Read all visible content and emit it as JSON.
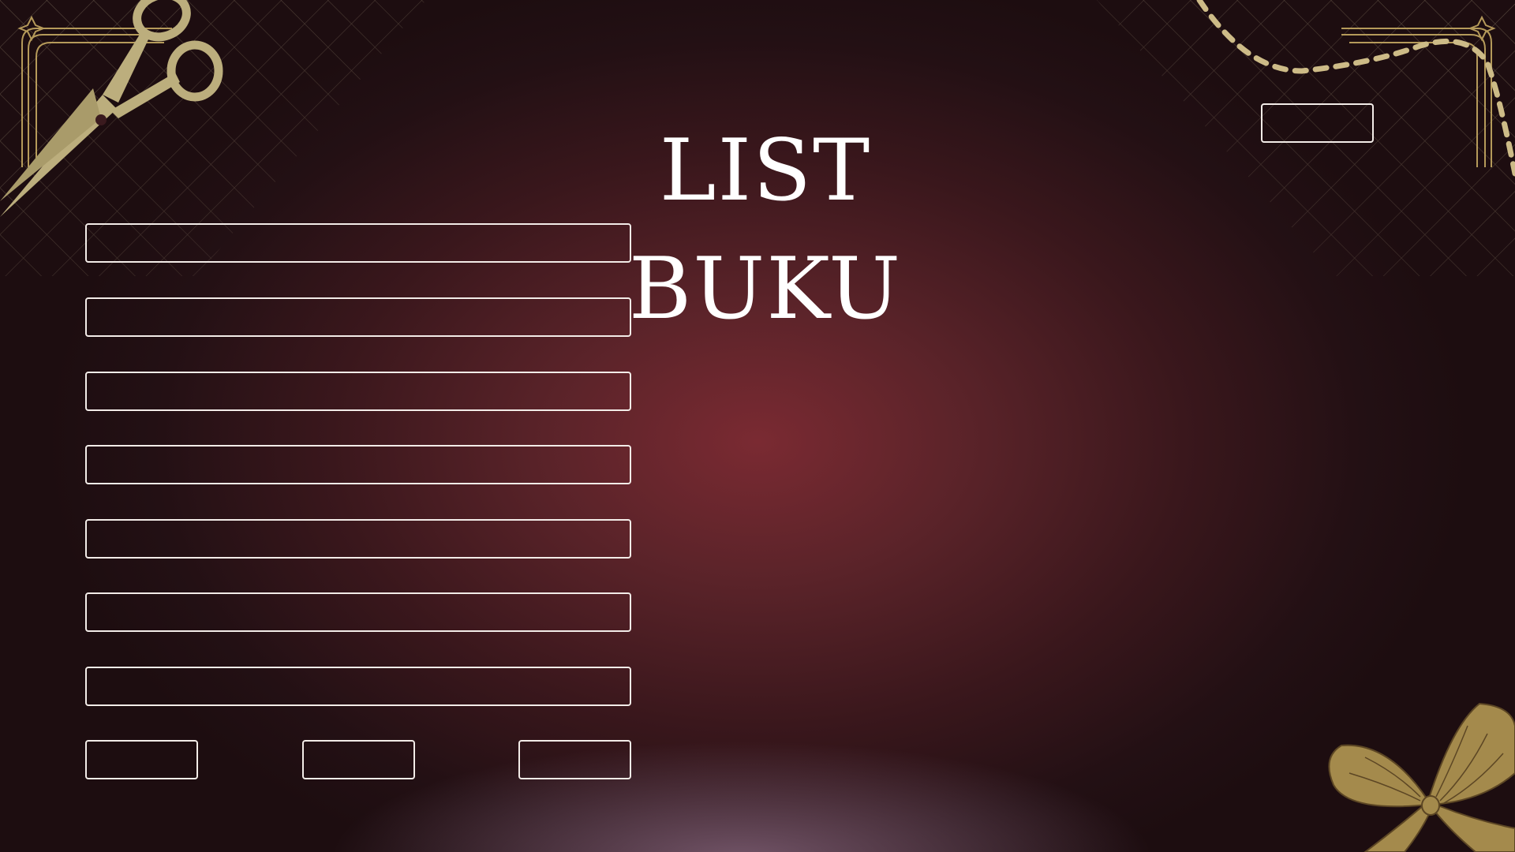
{
  "page": {
    "title": "LIST BUKU"
  },
  "form": {
    "fields": [
      {
        "value": "",
        "placeholder": ""
      },
      {
        "value": "",
        "placeholder": ""
      },
      {
        "value": "",
        "placeholder": ""
      },
      {
        "value": "",
        "placeholder": ""
      },
      {
        "value": "",
        "placeholder": ""
      },
      {
        "value": "",
        "placeholder": ""
      },
      {
        "value": "",
        "placeholder": ""
      }
    ],
    "buttons": [
      {
        "label": ""
      },
      {
        "label": ""
      },
      {
        "label": ""
      }
    ]
  },
  "header": {
    "top_right_button_label": ""
  },
  "colors": {
    "background_center": "#7a2a32",
    "background_edge": "#1d0d10",
    "outline": "#f3ece8",
    "gold": "#b9a87a",
    "title_text": "#ffffff"
  },
  "icons": [
    "scissors-icon",
    "ribbon-bow-icon",
    "corner-ornament-icon",
    "lattice-pattern",
    "dotted-thread"
  ]
}
